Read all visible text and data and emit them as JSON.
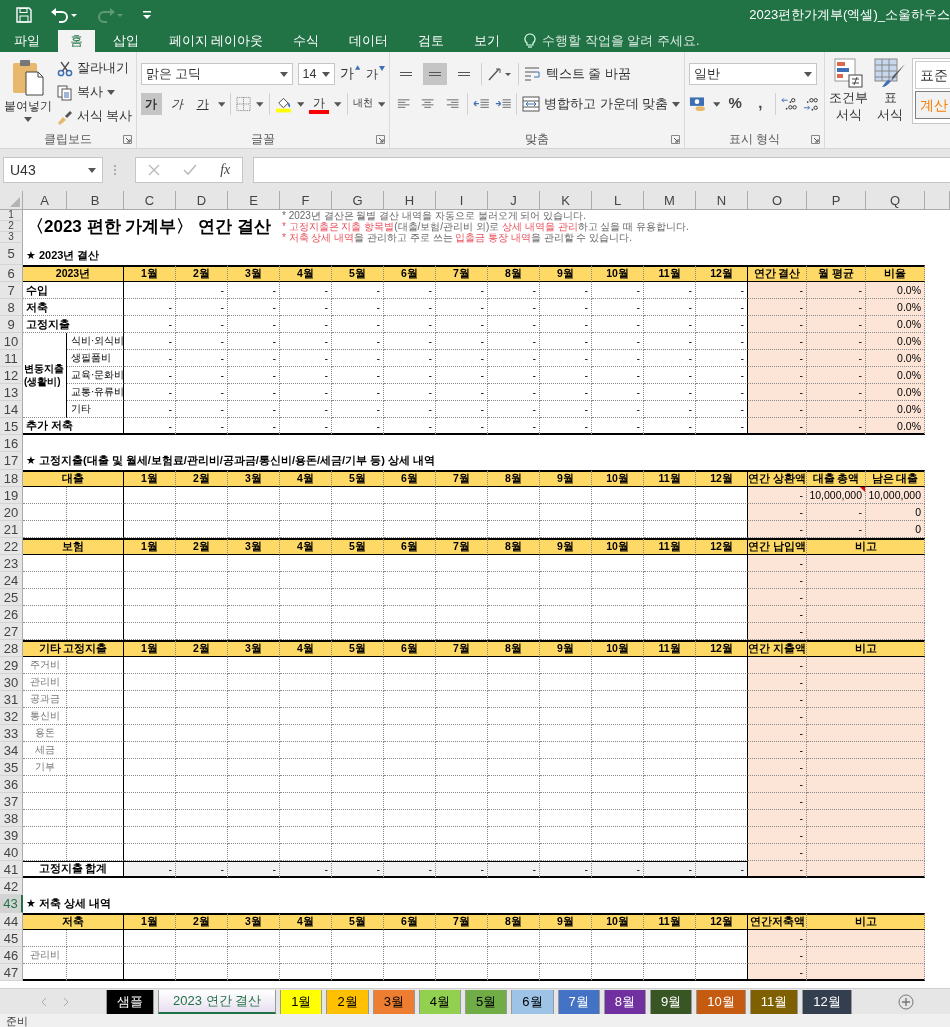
{
  "title_bar": {
    "title": "2023편한가계부(엑셀)_소울하우스"
  },
  "ribbon_tabs": [
    {
      "label": "파일",
      "selected": false
    },
    {
      "label": "홈",
      "selected": true
    },
    {
      "label": "삽입",
      "selected": false
    },
    {
      "label": "페이지 레이아웃",
      "selected": false
    },
    {
      "label": "수식",
      "selected": false
    },
    {
      "label": "데이터",
      "selected": false
    },
    {
      "label": "검토",
      "selected": false
    },
    {
      "label": "보기",
      "selected": false
    }
  ],
  "tell_me": {
    "placeholder": "수행할 작업을 알려 주세요."
  },
  "ribbon": {
    "clipboard": {
      "paste": "붙여넣기",
      "cut": "잘라내기",
      "copy": "복사",
      "format_painter": "서식 복사",
      "group_label": "클립보드"
    },
    "font": {
      "font_name": "맑은 고딕",
      "font_size": "14",
      "grow": "가",
      "shrink": "가",
      "styles": [
        {
          "label": "가",
          "kind": "bold",
          "pressed": true
        },
        {
          "label": "가",
          "kind": "italic",
          "pressed": false
        },
        {
          "label": "가",
          "kind": "underline",
          "pressed": false
        }
      ],
      "font_color": "가",
      "phonetic": "내천",
      "group_label": "글꼴"
    },
    "alignment": {
      "vertical": [
        {
          "pressed": false
        },
        {
          "pressed": true
        },
        {
          "pressed": false
        }
      ],
      "wrap_text": "텍스트 줄 바꿈",
      "merge": "병합하고 가운데 맞춤",
      "group_label": "맞춤"
    },
    "number": {
      "format": "일반",
      "percent": "%",
      "comma": ",",
      "group_label": "표시 형식"
    },
    "styles": {
      "conditional": "조건부\n서식",
      "table": "표\n서식",
      "gallery": [
        {
          "label": "표준",
          "kind": "normal"
        },
        {
          "label": "계산",
          "kind": "calculation"
        }
      ]
    }
  },
  "formula_bar": {
    "name_box": "U43",
    "function_label": "fx"
  },
  "sheet": {
    "columns": [
      "A",
      "B",
      "C",
      "D",
      "E",
      "F",
      "G",
      "H",
      "I",
      "J",
      "K",
      "L",
      "M",
      "N",
      "O",
      "P",
      "Q"
    ],
    "title_block": {
      "rows": [
        {
          "n": "1",
          "selected": false
        },
        {
          "n": "2",
          "selected": false
        },
        {
          "n": "3",
          "selected": false
        }
      ],
      "title": "〈2023 편한 가계부〉 연간 결산",
      "notes": [
        {
          "segments": [
            {
              "text": "* 2023년 결산은 월별 결산 내역을 자동으로 불러오게 되어 있습니다.",
              "highlight": false
            }
          ]
        },
        {
          "segments": [
            {
              "text": "* 고정지출은 지출 항목별",
              "highlight": true
            },
            {
              "text": "(대출/보험/관리비 외)로 ",
              "highlight": false
            },
            {
              "text": "상세 내역을 관리",
              "highlight": true
            },
            {
              "text": "하고 싶을 때 유용합니다.",
              "highlight": false
            }
          ]
        },
        {
          "segments": [
            {
              "text": "* 저축 상세 내역",
              "highlight": true
            },
            {
              "text": "을 관리하고 주로 쓰는 ",
              "highlight": false
            },
            {
              "text": "입출금 통장 내역",
              "highlight": true
            },
            {
              "text": "을 관리할 수 있습니다.",
              "highlight": false
            }
          ]
        }
      ]
    },
    "rows": [
      {
        "n": "5",
        "selected": false,
        "kind": "section",
        "text": "★ 2023년 결산"
      },
      {
        "n": "6",
        "selected": false,
        "kind": "header",
        "label": "2023년",
        "months": [
          "1월",
          "2월",
          "3월",
          "4월",
          "5월",
          "6월",
          "7월",
          "8월",
          "9월",
          "10월",
          "11월",
          "12월"
        ],
        "summary": [
          "연간 결산",
          "월 평균",
          "비율"
        ]
      },
      {
        "n": "7",
        "selected": false,
        "kind": "data",
        "label": "수입",
        "months": [
          "-",
          "-",
          "-",
          "-",
          "-",
          "-",
          "-",
          "-",
          "-",
          "-",
          "-"
        ],
        "summary": [
          "-",
          "-",
          "0.0%"
        ]
      },
      {
        "n": "8",
        "selected": false,
        "kind": "data",
        "label": "저축",
        "months": [
          "-",
          "-",
          "-",
          "-",
          "-",
          "-",
          "-",
          "-",
          "-",
          "-",
          "-",
          "-"
        ],
        "summary": [
          "-",
          "-",
          "0.0%"
        ]
      },
      {
        "n": "9",
        "selected": false,
        "kind": "data",
        "label": "고정지출",
        "months": [
          "-",
          "-",
          "-",
          "-",
          "-",
          "-",
          "-",
          "-",
          "-",
          "-",
          "-",
          "-"
        ],
        "summary": [
          "-",
          "-",
          "0.0%"
        ]
      },
      {
        "kind": "group",
        "label": "변동지출 (생활비)",
        "children": [
          {
            "n": "10",
            "selected": false,
            "kind": "sub",
            "label": "식비·외식비",
            "months": [
              "-",
              "-",
              "-",
              "-",
              "-",
              "-",
              "-",
              "-",
              "-",
              "-",
              "-",
              "-"
            ],
            "summary": [
              "-",
              "-",
              "0.0%"
            ]
          },
          {
            "n": "11",
            "selected": false,
            "kind": "sub",
            "label": "생필품비",
            "months": [
              "-",
              "-",
              "-",
              "-",
              "-",
              "-",
              "-",
              "-",
              "-",
              "-",
              "-",
              "-"
            ],
            "summary": [
              "-",
              "-",
              "0.0%"
            ]
          },
          {
            "n": "12",
            "selected": false,
            "kind": "sub",
            "label": "교육·문화비",
            "months": [
              "-",
              "-",
              "-",
              "-",
              "-",
              "-",
              "-",
              "-",
              "-",
              "-",
              "-",
              "-"
            ],
            "summary": [
              "-",
              "-",
              "0.0%"
            ]
          },
          {
            "n": "13",
            "selected": false,
            "kind": "sub",
            "label": "교통·유류비",
            "months": [
              "-",
              "-",
              "-",
              "-",
              "-",
              "-",
              "-",
              "-",
              "-",
              "-",
              "-",
              "-"
            ],
            "summary": [
              "-",
              "-",
              "0.0%"
            ]
          },
          {
            "n": "14",
            "selected": false,
            "kind": "sub",
            "label": "기타",
            "months": [
              "-",
              "-",
              "-",
              "-",
              "-",
              "-",
              "-",
              "-",
              "-",
              "-",
              "-",
              "-"
            ],
            "summary": [
              "-",
              "-",
              "0.0%"
            ]
          }
        ]
      },
      {
        "n": "15",
        "selected": false,
        "kind": "data",
        "label": "추가 저축",
        "months": [
          "-",
          "-",
          "-",
          "-",
          "-",
          "-",
          "-",
          "-",
          "-",
          "-",
          "-",
          "-"
        ],
        "summary": [
          "-",
          "-",
          "0.0%"
        ]
      },
      {
        "n": "16",
        "selected": false,
        "kind": "blank"
      },
      {
        "n": "17",
        "selected": false,
        "kind": "section",
        "text": "★ 고정지출(대출 및 월세/보험료/관리비/공과금/통신비/용돈/세금/기부 등) 상세 내역"
      },
      {
        "n": "18",
        "selected": false,
        "kind": "header",
        "label": "대출",
        "months": [
          "1월",
          "2월",
          "3월",
          "4월",
          "5월",
          "6월",
          "7월",
          "8월",
          "9월",
          "10월",
          "11월",
          "12월"
        ],
        "summary": [
          "연간 상환액",
          "대출 총액",
          "남은 대출"
        ]
      },
      {
        "n": "19",
        "selected": false,
        "kind": "entry",
        "comment": true,
        "summary": [
          "-",
          "10,000,000",
          "10,000,000"
        ]
      },
      {
        "n": "20",
        "selected": false,
        "kind": "entry",
        "comment": false,
        "summary": [
          "-",
          "-",
          "0"
        ]
      },
      {
        "n": "21",
        "selected": false,
        "kind": "entry",
        "comment": false,
        "summary": [
          "-",
          "-",
          "0"
        ]
      },
      {
        "n": "22",
        "selected": false,
        "kind": "header",
        "label": "보험",
        "months": [
          "1월",
          "2월",
          "3월",
          "4월",
          "5월",
          "6월",
          "7월",
          "8월",
          "9월",
          "10월",
          "11월",
          "12월"
        ],
        "summary": [
          "연간 납입액",
          "비고"
        ]
      },
      {
        "n": "23",
        "selected": false,
        "kind": "entry",
        "summary": [
          "-"
        ]
      },
      {
        "n": "24",
        "selected": false,
        "kind": "entry",
        "summary": [
          "-"
        ]
      },
      {
        "n": "25",
        "selected": false,
        "kind": "entry",
        "summary": [
          "-"
        ]
      },
      {
        "n": "26",
        "selected": false,
        "kind": "entry",
        "summary": [
          "-"
        ]
      },
      {
        "n": "27",
        "selected": false,
        "kind": "entry",
        "summary": [
          "-"
        ]
      },
      {
        "n": "28",
        "selected": false,
        "kind": "header",
        "label": "기타 고정지출",
        "months": [
          "1월",
          "2월",
          "3월",
          "4월",
          "5월",
          "6월",
          "7월",
          "8월",
          "9월",
          "10월",
          "11월",
          "12월"
        ],
        "summary": [
          "연간 지출액",
          "비고"
        ]
      },
      {
        "n": "29",
        "selected": false,
        "kind": "entry",
        "label": "주거비",
        "summary": [
          "-"
        ]
      },
      {
        "n": "30",
        "selected": false,
        "kind": "entry",
        "label": "관리비",
        "summary": [
          "-"
        ]
      },
      {
        "n": "31",
        "selected": false,
        "kind": "entry",
        "label": "공과금",
        "summary": [
          "-"
        ]
      },
      {
        "n": "32",
        "selected": false,
        "kind": "entry",
        "label": "통신비",
        "summary": [
          "-"
        ]
      },
      {
        "n": "33",
        "selected": false,
        "kind": "entry",
        "label": "용돈",
        "summary": [
          "-"
        ]
      },
      {
        "n": "34",
        "selected": false,
        "kind": "entry",
        "label": "세금",
        "summary": [
          "-"
        ]
      },
      {
        "n": "35",
        "selected": false,
        "kind": "entry",
        "label": "기부",
        "summary": [
          "-"
        ]
      },
      {
        "n": "36",
        "selected": false,
        "kind": "entry",
        "summary": [
          "-"
        ]
      },
      {
        "n": "37",
        "selected": false,
        "kind": "entry",
        "summary": [
          "-"
        ]
      },
      {
        "n": "38",
        "selected": false,
        "kind": "entry",
        "summary": [
          "-"
        ]
      },
      {
        "n": "39",
        "selected": false,
        "kind": "entry",
        "summary": [
          "-"
        ]
      },
      {
        "n": "40",
        "selected": false,
        "kind": "entry",
        "summary": [
          "-"
        ]
      },
      {
        "n": "41",
        "selected": false,
        "kind": "total",
        "label": "고정지출 합계",
        "months": [
          "-",
          "-",
          "-",
          "-",
          "-",
          "-",
          "-",
          "-",
          "-",
          "-",
          "-",
          "-"
        ],
        "summary": [
          "-"
        ]
      },
      {
        "n": "42",
        "selected": false,
        "kind": "blank"
      },
      {
        "n": "43",
        "selected": true,
        "kind": "section",
        "text": "★ 저축 상세 내역"
      },
      {
        "n": "44",
        "selected": false,
        "kind": "header",
        "label": "저축",
        "months": [
          "1월",
          "2월",
          "3월",
          "4월",
          "5월",
          "6월",
          "7월",
          "8월",
          "9월",
          "10월",
          "11월",
          "12월"
        ],
        "summary": [
          "연간저축액",
          "비고"
        ]
      },
      {
        "n": "45",
        "selected": false,
        "kind": "entry",
        "summary": [
          "-"
        ]
      },
      {
        "n": "46",
        "selected": false,
        "kind": "entry",
        "label": "관리비",
        "summary": [
          "-"
        ]
      },
      {
        "n": "47",
        "selected": false,
        "kind": "entry",
        "summary": [
          "-"
        ]
      }
    ]
  },
  "sheet_tabs": [
    {
      "label": "샘플",
      "selected": false,
      "color": "#000000"
    },
    {
      "label": "2023 연간 결산",
      "selected": true
    },
    {
      "label": "1월",
      "selected": false,
      "color": "#ffff00"
    },
    {
      "label": "2월",
      "selected": false,
      "color": "#ffc000"
    },
    {
      "label": "3월",
      "selected": false,
      "color": "#ed7d31"
    },
    {
      "label": "4월",
      "selected": false,
      "color": "#92d050"
    },
    {
      "label": "5월",
      "selected": false,
      "color": "#70ad47"
    },
    {
      "label": "6월",
      "selected": false,
      "color": "#9dc3e6"
    },
    {
      "label": "7월",
      "selected": false,
      "color": "#4472c4"
    },
    {
      "label": "8월",
      "selected": false,
      "color": "#7030a0"
    },
    {
      "label": "9월",
      "selected": false,
      "color": "#375623"
    },
    {
      "label": "10월",
      "selected": false,
      "color": "#c55a11"
    },
    {
      "label": "11월",
      "selected": false,
      "color": "#7f6000"
    },
    {
      "label": "12월",
      "selected": false,
      "color": "#333f4f"
    }
  ],
  "status_bar": {
    "text": "준비"
  }
}
